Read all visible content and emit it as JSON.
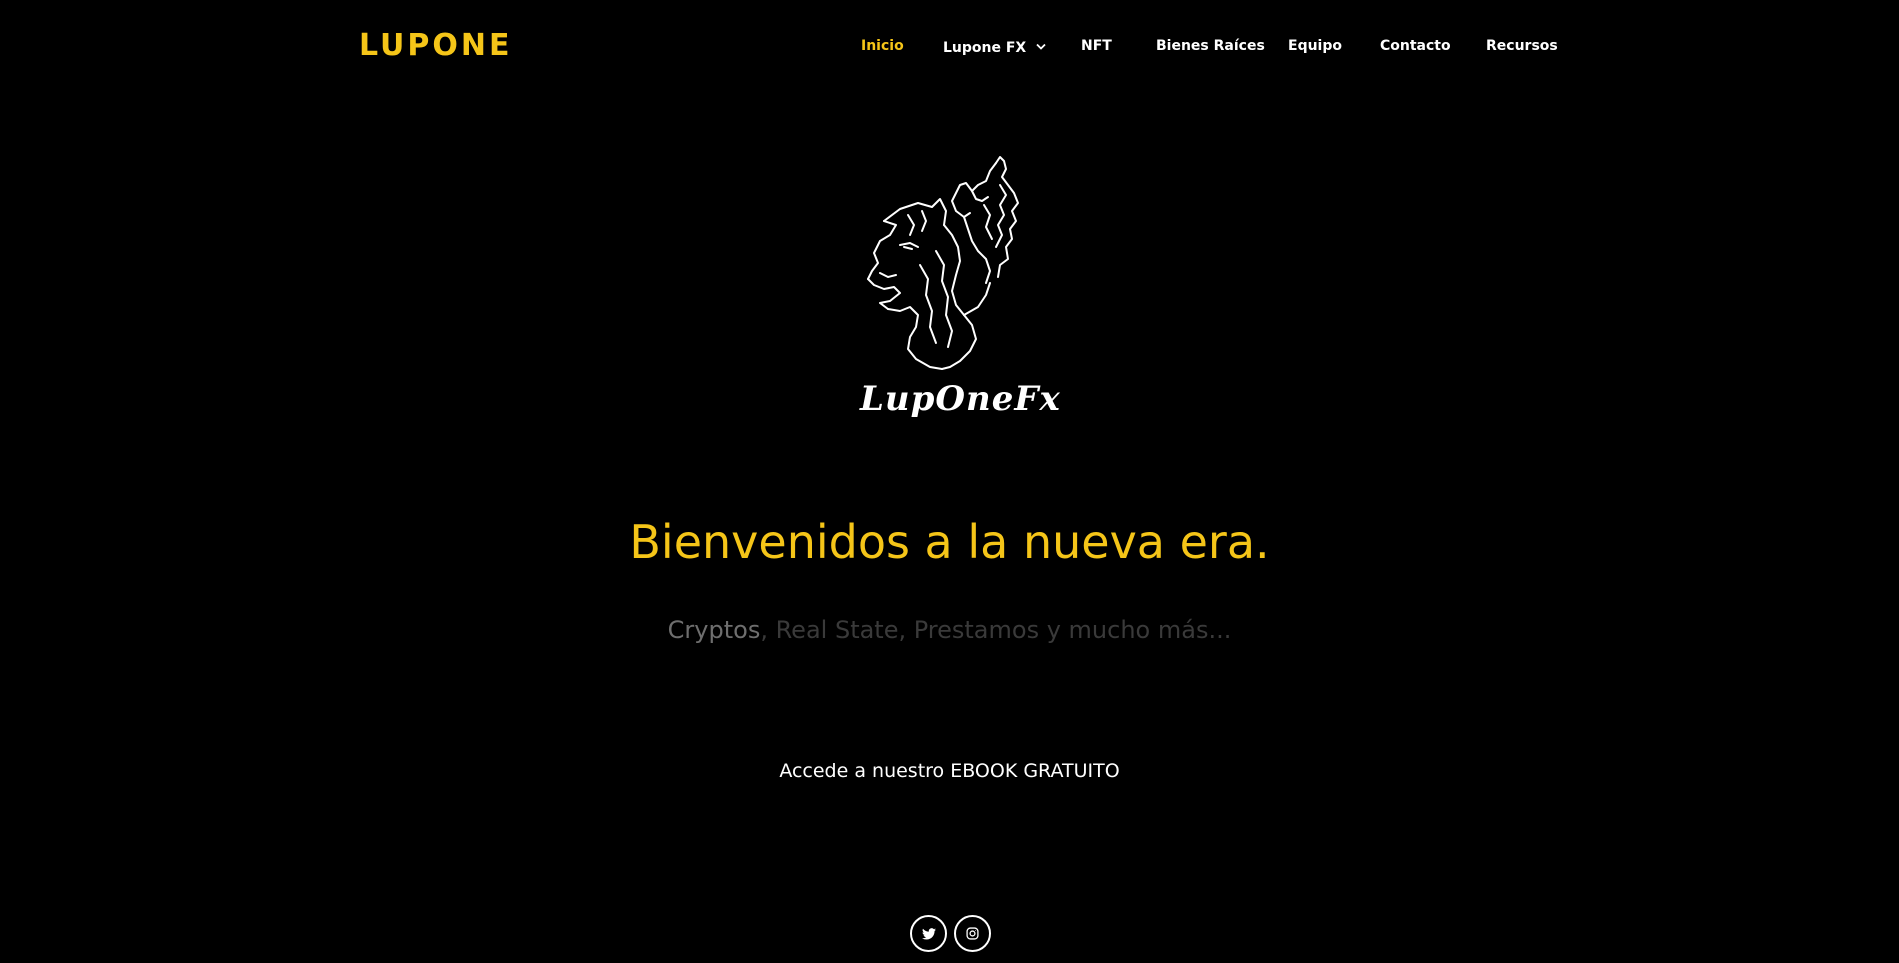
{
  "header": {
    "brand": "LUPONE",
    "nav": [
      {
        "label": "Inicio",
        "active": true
      },
      {
        "label": "Lupone FX",
        "dropdown": true
      },
      {
        "label": "NFT"
      },
      {
        "label": "Bienes Raíces"
      },
      {
        "label": "Equipo"
      },
      {
        "label": "Contacto"
      },
      {
        "label": "Recursos"
      }
    ]
  },
  "logo": {
    "icon": "wolf-head-icon",
    "wordmark": "LupOneFx"
  },
  "hero": {
    "title": "Bienvenidos a la nueva era.",
    "subtitle_highlight": "Cryptos",
    "subtitle_rest": ", Real State, Prestamos y mucho más..."
  },
  "cta": {
    "ebook_label": "Accede a nuestro EBOOK GRATUITO"
  },
  "social": [
    {
      "icon": "twitter-icon"
    },
    {
      "icon": "instagram-icon"
    }
  ],
  "colors": {
    "accent": "#f5c518",
    "background": "#000000",
    "text": "#ffffff",
    "muted": "#3a3a3a"
  }
}
